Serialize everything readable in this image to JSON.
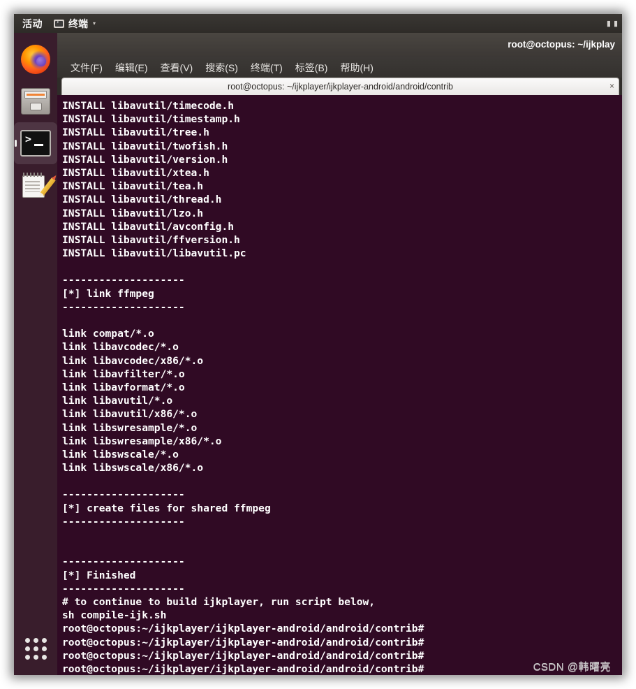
{
  "topbar": {
    "activities": "活动",
    "app_icon": "terminal-icon",
    "app_name": "终端",
    "caret": "▾",
    "tray": [
      "network-icon",
      "volume-icon",
      "power-icon"
    ]
  },
  "dock": {
    "items": [
      {
        "name": "firefox",
        "icon": "firefox-icon",
        "active": false
      },
      {
        "name": "files",
        "icon": "file-manager-icon",
        "active": false
      },
      {
        "name": "terminal",
        "icon": "terminal-icon",
        "active": true
      },
      {
        "name": "text-editor",
        "icon": "text-editor-icon",
        "active": false
      }
    ],
    "show_apps_icon": "grid-dots-icon"
  },
  "window": {
    "title": "root@octopus: ~/ijkplay",
    "menu": [
      "文件(F)",
      "编辑(E)",
      "查看(V)",
      "搜索(S)",
      "终端(T)",
      "标签(B)",
      "帮助(H)"
    ],
    "tab": {
      "title": "root@octopus: ~/ijkplayer/ijkplayer-android/android/contrib",
      "close_icon": "×"
    },
    "colors": {
      "terminal_bg": "#300a24",
      "terminal_fg": "#ffffff",
      "titlebar_bg": "#3c3835",
      "dock_bg": "#3a1f2d"
    }
  },
  "terminal": {
    "lines": [
      "INSTALL libavutil/timecode.h",
      "INSTALL libavutil/timestamp.h",
      "INSTALL libavutil/tree.h",
      "INSTALL libavutil/twofish.h",
      "INSTALL libavutil/version.h",
      "INSTALL libavutil/xtea.h",
      "INSTALL libavutil/tea.h",
      "INSTALL libavutil/thread.h",
      "INSTALL libavutil/lzo.h",
      "INSTALL libavutil/avconfig.h",
      "INSTALL libavutil/ffversion.h",
      "INSTALL libavutil/libavutil.pc",
      "",
      "--------------------",
      "[*] link ffmpeg",
      "--------------------",
      "",
      "link compat/*.o",
      "link libavcodec/*.o",
      "link libavcodec/x86/*.o",
      "link libavfilter/*.o",
      "link libavformat/*.o",
      "link libavutil/*.o",
      "link libavutil/x86/*.o",
      "link libswresample/*.o",
      "link libswresample/x86/*.o",
      "link libswscale/*.o",
      "link libswscale/x86/*.o",
      "",
      "--------------------",
      "[*] create files for shared ffmpeg",
      "--------------------",
      "",
      "",
      "--------------------",
      "[*] Finished",
      "--------------------",
      "# to continue to build ijkplayer, run script below,",
      "sh compile-ijk.sh",
      "root@octopus:~/ijkplayer/ijkplayer-android/android/contrib#",
      "root@octopus:~/ijkplayer/ijkplayer-android/android/contrib#",
      "root@octopus:~/ijkplayer/ijkplayer-android/android/contrib#",
      "root@octopus:~/ijkplayer/ijkplayer-android/android/contrib#"
    ]
  },
  "watermark": "CSDN @韩曙亮"
}
